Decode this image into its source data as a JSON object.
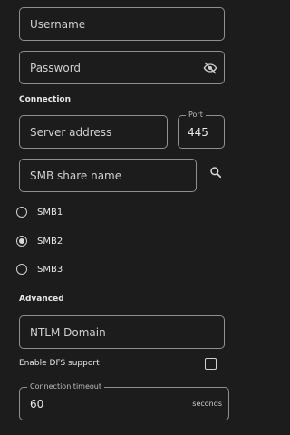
{
  "username": {
    "placeholder": "Username"
  },
  "password": {
    "placeholder": "Password",
    "icon": "visibility-off-icon"
  },
  "connection": {
    "heading": "Connection",
    "server_address_placeholder": "Server address",
    "port_label": "Port",
    "port_value": "445",
    "share_placeholder": "SMB share name",
    "search_icon": "search-icon"
  },
  "smb_versions": {
    "options": [
      "SMB1",
      "SMB2",
      "SMB3"
    ],
    "selected": "SMB2"
  },
  "advanced": {
    "heading": "Advanced",
    "ntlm_placeholder": "NTLM Domain",
    "dfs_label": "Enable DFS support",
    "dfs_checked": false,
    "timeout_label": "Connection timeout",
    "timeout_value": "60",
    "timeout_unit": "seconds"
  },
  "colors": {
    "background": "#1c1c1c",
    "outline": "#8f8f8f",
    "text": "#e6e6e6"
  }
}
